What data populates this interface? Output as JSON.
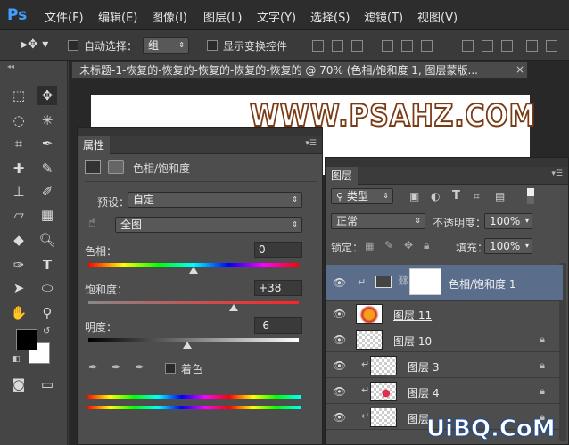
{
  "menubar": {
    "logo": "Ps",
    "items": [
      "文件(F)",
      "编辑(E)",
      "图像(I)",
      "图层(L)",
      "文字(Y)",
      "选择(S)",
      "滤镜(T)",
      "视图(V)"
    ]
  },
  "options": {
    "auto_select_label": "自动选择：",
    "auto_select_value": "组",
    "transform_label": "显示变换控件"
  },
  "document": {
    "tab_title": "未标题-1-恢复的-恢复的-恢复的-恢复的-恢复的 @ 70% (色相/饱和度 1, 图层蒙版...",
    "close": "×",
    "watermark": "WWW.PSAHZ.COM"
  },
  "properties": {
    "title": "属性",
    "adjustment_label": "色相/饱和度",
    "preset_label": "预设：",
    "preset_value": "自定",
    "range_value": "全图",
    "hue_label": "色相：",
    "hue_value": "0",
    "sat_label": "饱和度：",
    "sat_value": "+38",
    "light_label": "明度：",
    "light_value": "-6",
    "colorize_label": "着色",
    "hue": 0,
    "saturation": 38,
    "lightness": -6
  },
  "layers": {
    "title": "图层",
    "filter_kind": "类型",
    "blend_mode": "正常",
    "opacity_label": "不透明度：",
    "opacity_value": "100%",
    "lock_label": "锁定：",
    "fill_label": "填充：",
    "fill_value": "100%",
    "items": [
      {
        "name": "色相/饱和度 1",
        "selected": true
      },
      {
        "name": "图层 11"
      },
      {
        "name": "图层 10"
      },
      {
        "name": "图层 3"
      },
      {
        "name": "图层 4"
      },
      {
        "name": "图层"
      }
    ]
  },
  "watermark2": "UiBQ.CoM"
}
